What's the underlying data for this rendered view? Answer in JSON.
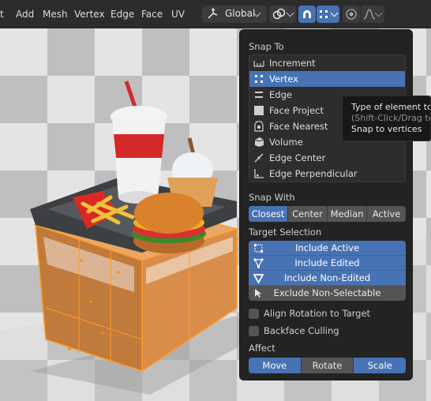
{
  "menu": [
    "t",
    "Add",
    "Mesh",
    "Vertex",
    "Edge",
    "Face",
    "UV"
  ],
  "header": {
    "orientation_label": "Global",
    "transform_pivot_icon": "link-pivot-icon",
    "snap_toggle_icon": "magnet-icon",
    "snap_target_icon": "vertex-grid-icon",
    "proportional_icon": "proportional-editing-icon",
    "falloff_icon": "falloff-curve-icon"
  },
  "snap_to": {
    "title": "Snap To",
    "items": [
      {
        "label": "Increment",
        "icon": "increment-icon",
        "selected": false
      },
      {
        "label": "Vertex",
        "icon": "vertex-icon",
        "selected": true
      },
      {
        "label": "Edge",
        "icon": "edge-icon",
        "selected": false
      },
      {
        "label": "Face Project",
        "icon": "face-project-icon",
        "selected": false
      },
      {
        "label": "Face Nearest",
        "icon": "face-nearest-icon",
        "selected": false
      },
      {
        "label": "Volume",
        "icon": "volume-icon",
        "selected": false
      },
      {
        "label": "Edge Center",
        "icon": "edge-center-icon",
        "selected": false
      },
      {
        "label": "Edge Perpendicular",
        "icon": "edge-perpendicular-icon",
        "selected": false
      }
    ]
  },
  "snap_with": {
    "title": "Snap With",
    "options": [
      "Closest",
      "Center",
      "Median",
      "Active"
    ],
    "selected": "Closest"
  },
  "target_selection": {
    "title": "Target Selection",
    "items": [
      {
        "label": "Include Active",
        "icon": "include-active-icon",
        "on": true
      },
      {
        "label": "Include Edited",
        "icon": "include-edited-icon",
        "on": true
      },
      {
        "label": "Include Non-Edited",
        "icon": "include-non-edited-icon",
        "on": true
      },
      {
        "label": "Exclude Non-Selectable",
        "icon": "cursor-arrow-icon",
        "on": false
      }
    ]
  },
  "options": {
    "align_rotation": {
      "label": "Align Rotation to Target",
      "checked": false
    },
    "backface_culling": {
      "label": "Backface Culling",
      "checked": false
    }
  },
  "affect": {
    "title": "Affect",
    "options": [
      {
        "label": "Move",
        "on": true
      },
      {
        "label": "Rotate",
        "on": false
      },
      {
        "label": "Scale",
        "on": true
      }
    ]
  },
  "tooltip": {
    "line1": "Type of element to s",
    "line2": "(Shift-Click/Drag to s",
    "line3": "Snap to vertices"
  },
  "colors": {
    "accent": "#4772b3",
    "panel": "#232323",
    "header": "#2c2c2c",
    "edit_orange": "#ff8c1a"
  }
}
